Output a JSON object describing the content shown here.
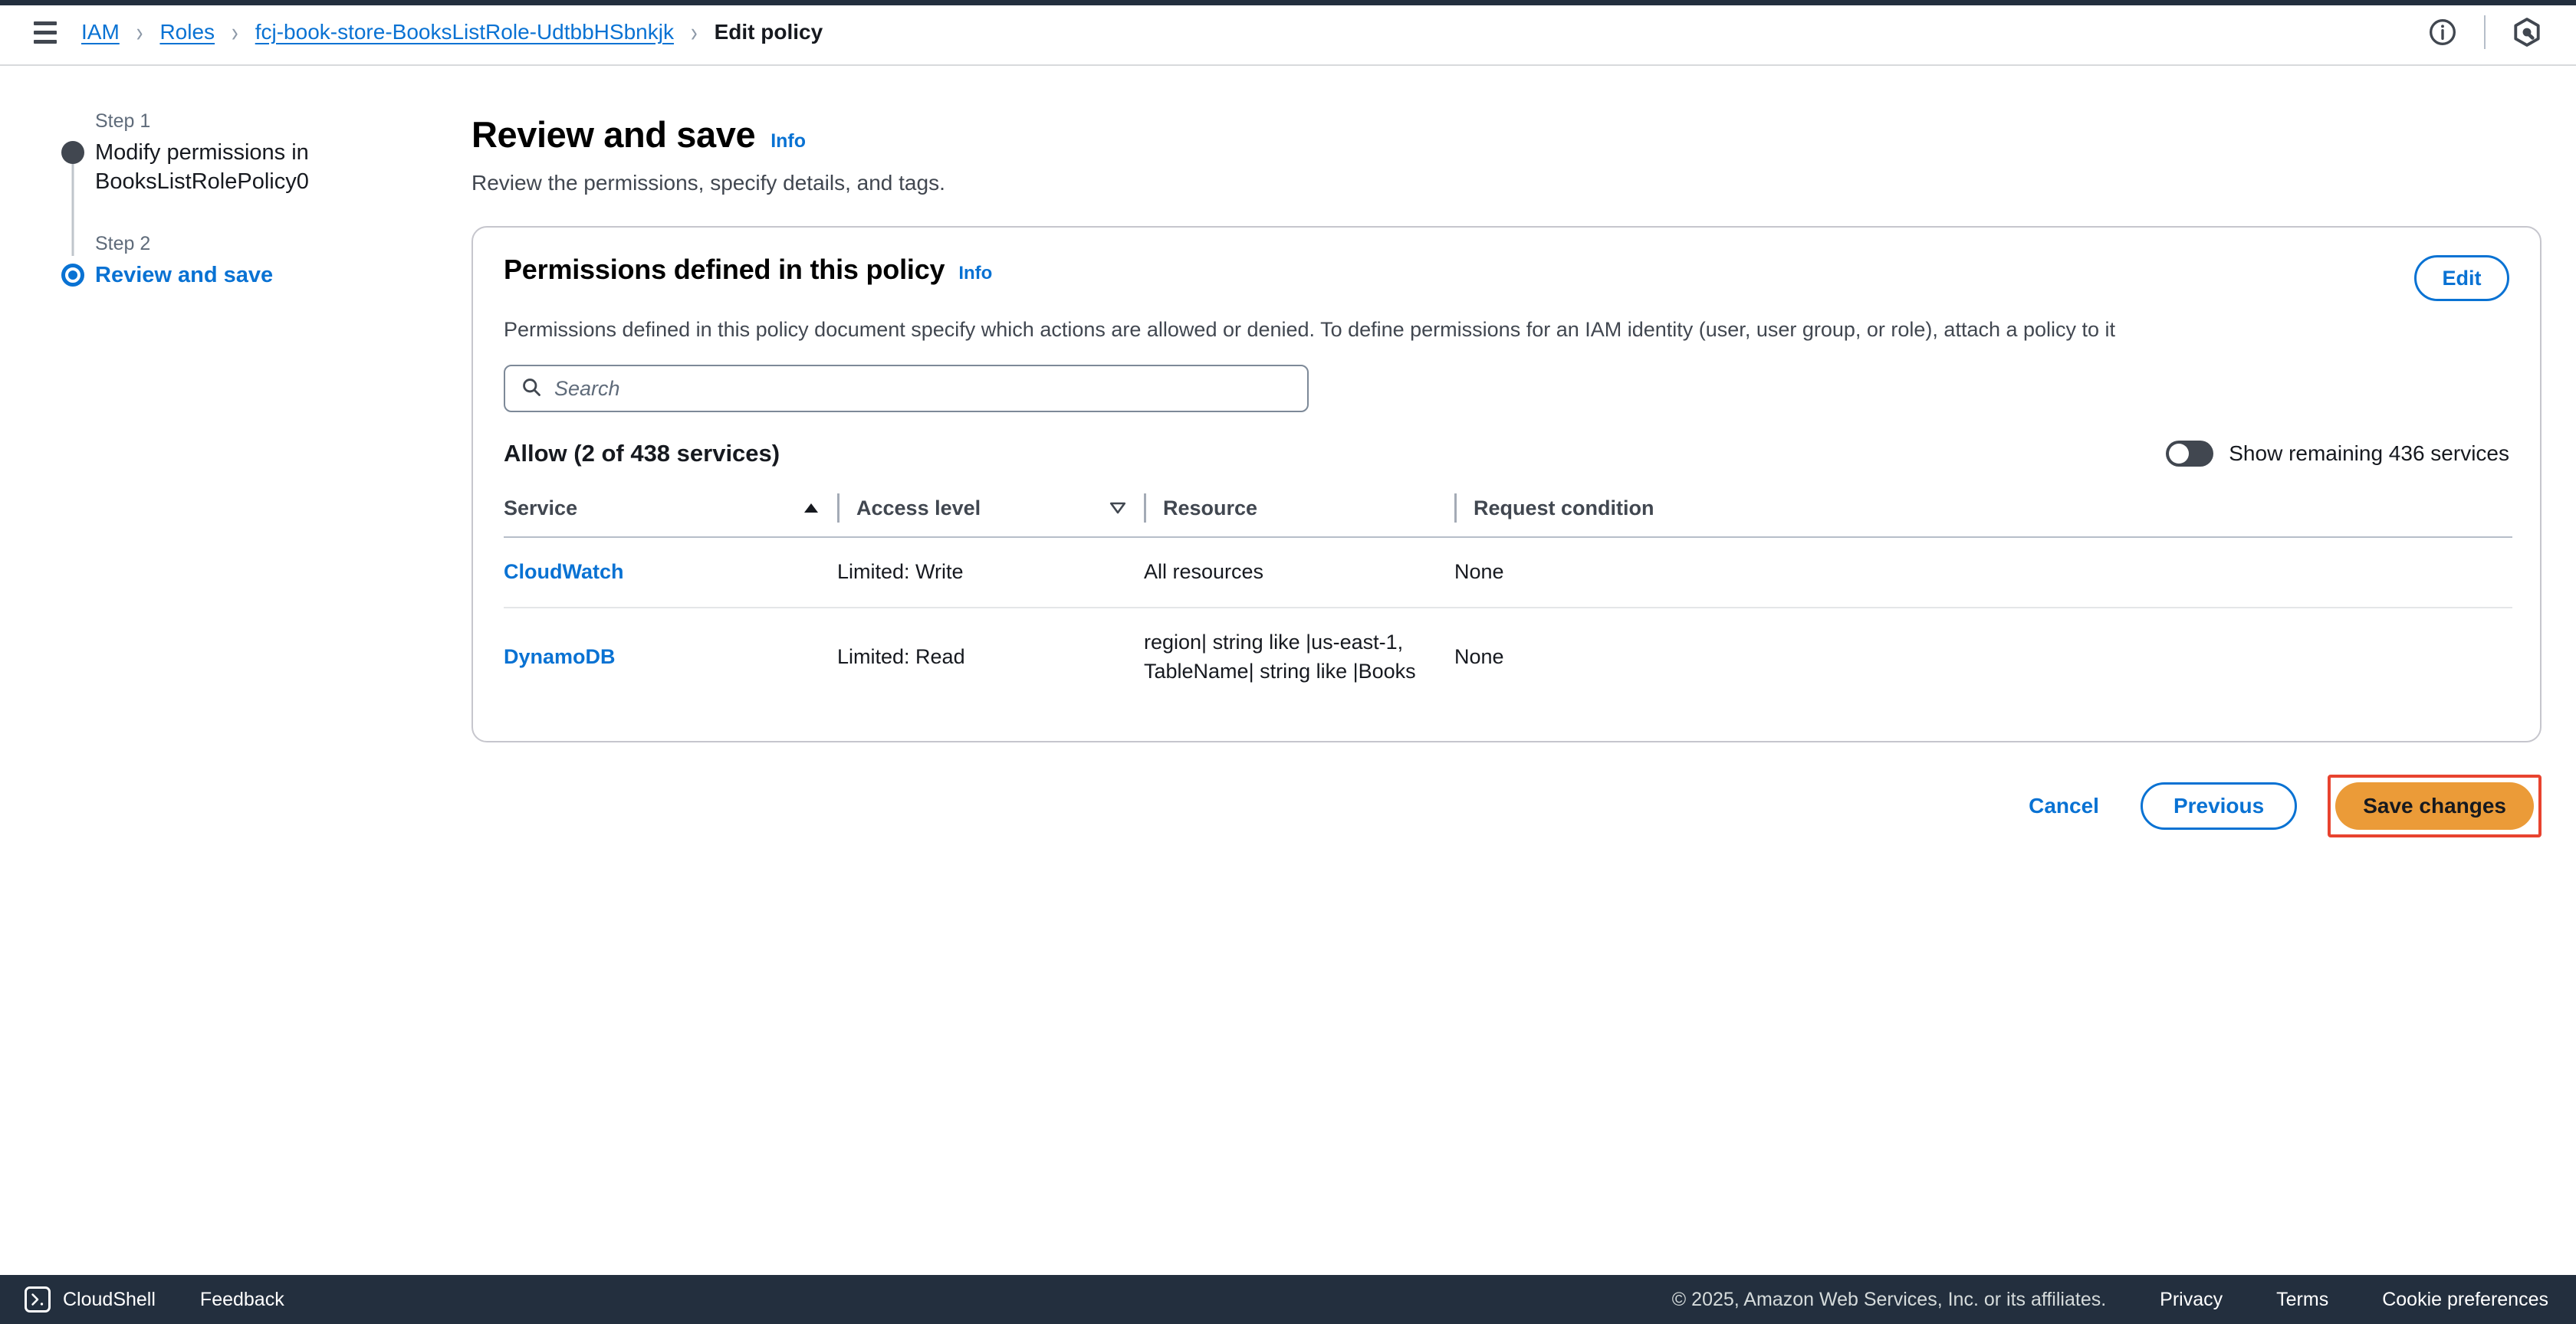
{
  "topbar": {
    "menu_icon": "hamburger-menu-icon",
    "breadcrumb": [
      {
        "label": "IAM",
        "link": true
      },
      {
        "label": "Roles",
        "link": true
      },
      {
        "label": "fcj-book-store-BooksListRole-UdtbbHSbnkjk",
        "link": true
      },
      {
        "label": "Edit policy",
        "link": false
      }
    ],
    "separator": "›",
    "info_icon": "info-circle-icon",
    "assistant_icon": "amazon-q-hexagon-icon"
  },
  "stepper": {
    "steps": [
      {
        "number": "Step 1",
        "title": "Modify permissions in BooksListRolePolicy0",
        "state": "done"
      },
      {
        "number": "Step 2",
        "title": "Review and save",
        "state": "active"
      }
    ]
  },
  "page": {
    "title": "Review and save",
    "info_label": "Info",
    "subtitle": "Review the permissions, specify details, and tags."
  },
  "card": {
    "title": "Permissions defined in this policy",
    "info_label": "Info",
    "edit_label": "Edit",
    "description": "Permissions defined in this policy document specify which actions are allowed or denied. To define permissions for an IAM identity (user, user group, or role), attach a policy to it",
    "search_placeholder": "Search",
    "search_value": "",
    "search_icon": "search-icon",
    "allow_heading": "Allow (2 of 438 services)",
    "toggle_label": "Show remaining 436 services",
    "toggle_state": "off"
  },
  "table": {
    "columns": [
      {
        "label": "Service",
        "sort": "ascending"
      },
      {
        "label": "Access level",
        "sort": "descending-inactive"
      },
      {
        "label": "Resource",
        "sort": "none"
      },
      {
        "label": "Request condition",
        "sort": "none"
      }
    ],
    "rows": [
      {
        "service": "CloudWatch",
        "access_level": "Limited: Write",
        "resource": "All resources",
        "request_condition": "None"
      },
      {
        "service": "DynamoDB",
        "access_level": "Limited: Read",
        "resource": "region| string like |us-east-1, TableName| string like |Books",
        "request_condition": "None"
      }
    ]
  },
  "actions": {
    "cancel_label": "Cancel",
    "previous_label": "Previous",
    "save_label": "Save changes",
    "save_highlight_color": "#e8432f",
    "save_background_color": "#eb9b38"
  },
  "footer": {
    "cloudshell_label": "CloudShell",
    "cloudshell_icon": "terminal-prompt-icon",
    "feedback_label": "Feedback",
    "copyright": "© 2025, Amazon Web Services, Inc. or its affiliates.",
    "links": [
      "Privacy",
      "Terms",
      "Cookie preferences"
    ]
  }
}
